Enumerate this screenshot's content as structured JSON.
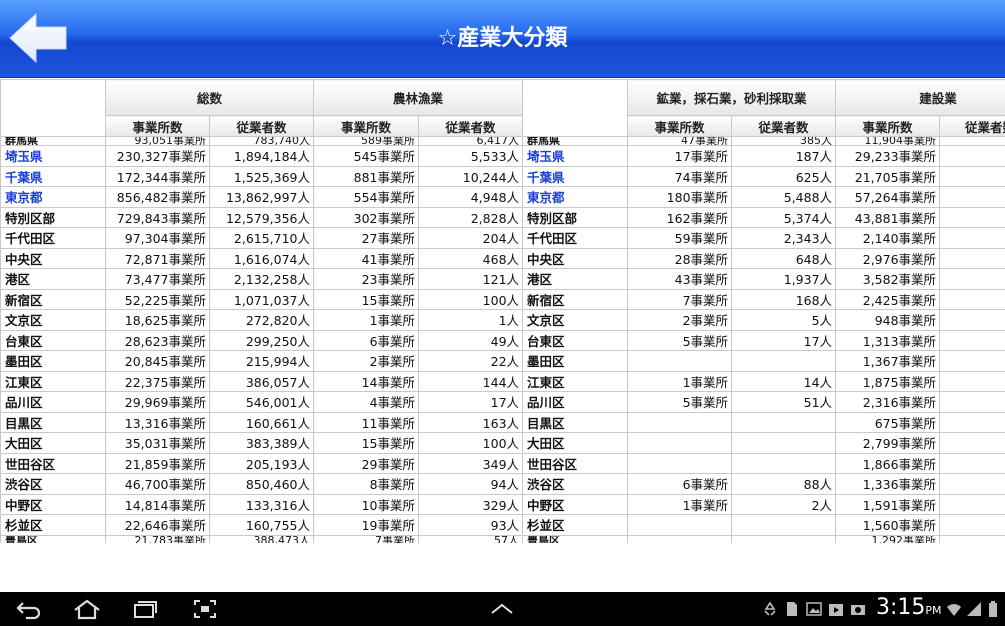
{
  "header": {
    "title": "☆産業大分類",
    "back_icon": "back-arrow-icon"
  },
  "table": {
    "groups": [
      "総数",
      "農林漁業",
      "鉱業，採石業，砂利採取業",
      "建設業"
    ],
    "subheaders": [
      "事業所数",
      "従業者数"
    ],
    "top_partial": [
      "群馬県",
      "93,051事業所",
      "783,740人",
      "589事業所",
      "6,417人",
      "群馬県",
      "47事業所",
      "385人",
      "11,904事業所",
      "30"
    ],
    "rows": [
      {
        "name": "埼玉県",
        "link": true,
        "t_est": "230,327事業所",
        "t_emp": "1,894,184人",
        "a_est": "545事業所",
        "a_emp": "5,533人",
        "m_est": "17事業所",
        "m_emp": "187人",
        "c_est": "29,233事業所",
        "c_emp": "173"
      },
      {
        "name": "千葉県",
        "link": true,
        "t_est": "172,344事業所",
        "t_emp": "1,525,369人",
        "a_est": "881事業所",
        "a_emp": "10,244人",
        "m_est": "74事業所",
        "m_emp": "625人",
        "c_est": "21,705事業所",
        "c_emp": "140"
      },
      {
        "name": "東京都",
        "link": true,
        "t_est": "856,482事業所",
        "t_emp": "13,862,997人",
        "a_est": "554事業所",
        "a_emp": "4,948人",
        "m_est": "180事業所",
        "m_emp": "5,488人",
        "c_est": "57,264事業所",
        "c_emp": "672"
      },
      {
        "name": "特別区部",
        "link": false,
        "t_est": "729,843事業所",
        "t_emp": "12,579,356人",
        "a_est": "302事業所",
        "a_emp": "2,828人",
        "m_est": "162事業所",
        "m_emp": "5,374人",
        "c_est": "43,881事業所",
        "c_emp": "590"
      },
      {
        "name": "千代田区",
        "link": false,
        "t_est": "97,304事業所",
        "t_emp": "2,615,710人",
        "a_est": "27事業所",
        "a_emp": "204人",
        "m_est": "59事業所",
        "m_emp": "2,343人",
        "c_est": "2,140事業所",
        "c_emp": "41"
      },
      {
        "name": "中央区",
        "link": false,
        "t_est": "72,871事業所",
        "t_emp": "1,616,074人",
        "a_est": "41事業所",
        "a_emp": "468人",
        "m_est": "28事業所",
        "m_emp": "648人",
        "c_est": "2,976事業所",
        "c_emp": "59"
      },
      {
        "name": "港区",
        "link": false,
        "t_est": "73,477事業所",
        "t_emp": "2,132,258人",
        "a_est": "23事業所",
        "a_emp": "121人",
        "m_est": "43事業所",
        "m_emp": "1,937人",
        "c_est": "3,582事業所",
        "c_emp": "108"
      },
      {
        "name": "新宿区",
        "link": false,
        "t_est": "52,225事業所",
        "t_emp": "1,071,037人",
        "a_est": "15事業所",
        "a_emp": "100人",
        "m_est": "7事業所",
        "m_emp": "168人",
        "c_est": "2,425事業所",
        "c_emp": "55"
      },
      {
        "name": "文京区",
        "link": false,
        "t_est": "18,625事業所",
        "t_emp": "272,820人",
        "a_est": "1事業所",
        "a_emp": "1人",
        "m_est": "2事業所",
        "m_emp": "5人",
        "c_est": "948事業所",
        "c_emp": "14"
      },
      {
        "name": "台東区",
        "link": false,
        "t_est": "28,623事業所",
        "t_emp": "299,250人",
        "a_est": "6事業所",
        "a_emp": "49人",
        "m_est": "5事業所",
        "m_emp": "17人",
        "c_est": "1,313事業所",
        "c_emp": "15"
      },
      {
        "name": "墨田区",
        "link": false,
        "t_est": "20,845事業所",
        "t_emp": "215,994人",
        "a_est": "2事業所",
        "a_emp": "22人",
        "m_est": "",
        "m_emp": "",
        "c_est": "1,367事業所",
        "c_emp": "11"
      },
      {
        "name": "江東区",
        "link": false,
        "t_est": "22,375事業所",
        "t_emp": "386,057人",
        "a_est": "14事業所",
        "a_emp": "144人",
        "m_est": "1事業所",
        "m_emp": "14人",
        "c_est": "1,875事業所",
        "c_emp": "20"
      },
      {
        "name": "品川区",
        "link": false,
        "t_est": "29,969事業所",
        "t_emp": "546,001人",
        "a_est": "4事業所",
        "a_emp": "17人",
        "m_est": "5事業所",
        "m_emp": "51人",
        "c_est": "2,316事業所",
        "c_emp": "33"
      },
      {
        "name": "目黒区",
        "link": false,
        "t_est": "13,316事業所",
        "t_emp": "160,661人",
        "a_est": "11事業所",
        "a_emp": "163人",
        "m_est": "",
        "m_emp": "",
        "c_est": "675事業所",
        "c_emp": "6"
      },
      {
        "name": "大田区",
        "link": false,
        "t_est": "35,031事業所",
        "t_emp": "383,389人",
        "a_est": "15事業所",
        "a_emp": "100人",
        "m_est": "",
        "m_emp": "",
        "c_est": "2,799事業所",
        "c_emp": "23"
      },
      {
        "name": "世田谷区",
        "link": false,
        "t_est": "21,859事業所",
        "t_emp": "205,193人",
        "a_est": "29事業所",
        "a_emp": "349人",
        "m_est": "",
        "m_emp": "",
        "c_est": "1,866事業所",
        "c_emp": "14"
      },
      {
        "name": "渋谷区",
        "link": false,
        "t_est": "46,700事業所",
        "t_emp": "850,460人",
        "a_est": "8事業所",
        "a_emp": "94人",
        "m_est": "6事業所",
        "m_emp": "88人",
        "c_est": "1,336事業所",
        "c_emp": "28"
      },
      {
        "name": "中野区",
        "link": false,
        "t_est": "14,814事業所",
        "t_emp": "133,316人",
        "a_est": "10事業所",
        "a_emp": "329人",
        "m_est": "1事業所",
        "m_emp": "2人",
        "c_est": "1,591事業所",
        "c_emp": "20"
      },
      {
        "name": "杉並区",
        "link": false,
        "t_est": "22,646事業所",
        "t_emp": "160,755人",
        "a_est": "19事業所",
        "a_emp": "93人",
        "m_est": "",
        "m_emp": "",
        "c_est": "1,560事業所",
        "c_emp": "12"
      }
    ],
    "bottom_partial": [
      "豊島区",
      "21,783事業所",
      "388,473人",
      "7事業所",
      "57人",
      "豊島区",
      "",
      "",
      "1,292事業所",
      "21"
    ]
  },
  "status_bar": {
    "time": "3:15",
    "ampm": "PM"
  }
}
